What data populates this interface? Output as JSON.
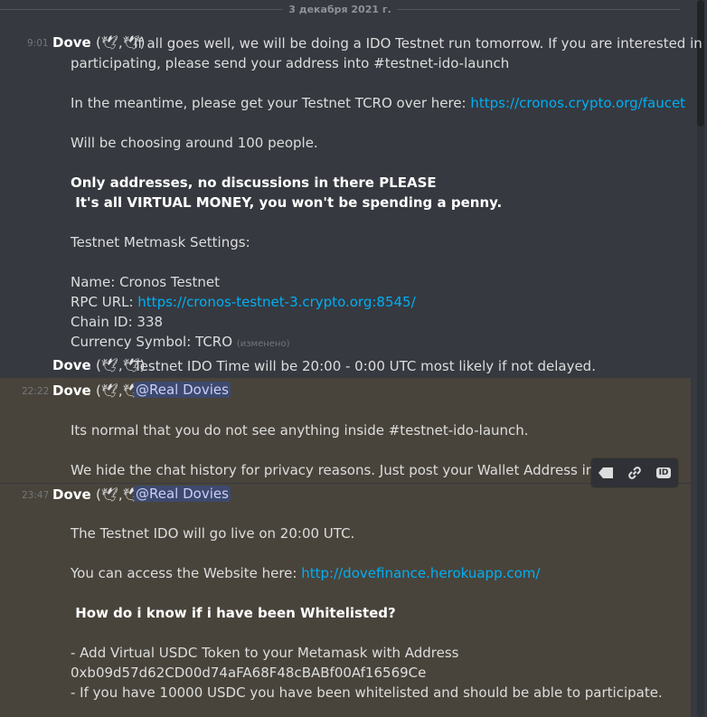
{
  "date_divider": "3 декабря 2021 г.",
  "messages": {
    "m1": {
      "timestamp": "9:01",
      "author": "Dove",
      "author_emoji": "(🕊,🕊)",
      "first_line": "If all goes well, we will be doing a IDO Testnet run tomorrow. If you are interested in",
      "lines": [
        "participating, please send your address into #testnet-ido-launch",
        "In the meantime, please get your Testnet TCRO over here: ",
        "Will be choosing around 100 people.",
        "Only addresses, no discussions in there PLEASE",
        " It's all VIRTUAL MONEY, you won't be spending a penny.",
        "Testnet Metmask Settings:",
        "Name: Cronos Testnet",
        "RPC URL: ",
        "Chain ID: 338",
        "Currency Symbol: TCRO "
      ],
      "faucet_link": "https://cronos.crypto.org/faucet",
      "rpc_link": "https://cronos-testnet-3.crypto.org:8545/",
      "edited": "(изменено)"
    },
    "m2": {
      "author": "Dove",
      "author_emoji": "(🕊,🕊)",
      "text": "Testnet IDO Time will be 20:00 - 0:00 UTC most likely if not delayed."
    },
    "m3": {
      "timestamp": "22:22",
      "author": "Dove",
      "author_emoji": "(🕊,🕊)",
      "mention": "@Real Dovies",
      "lines": [
        "Its normal that you do not see anything inside #testnet-ido-launch.",
        "We hide the chat history for privacy reasons. Just post your Wallet Address inside"
      ]
    },
    "m4": {
      "timestamp": "23:47",
      "author": "Dove",
      "author_emoji": "(🕊,🕊)",
      "mention": "@Real Dovies",
      "lines": [
        "The Testnet IDO will go live on 20:00 UTC.",
        "You can access the Website here: ",
        " How do i know if i have been Whitelisted?",
        "- Add Virtual USDC Token to your Metamask with Address",
        "0xb09d57d62CD00d74aFA68F48cBABf00Af16569Ce",
        "- If you have 10000 USDC you have been whitelisted and should be able to participate."
      ],
      "website_link": "http://dovefinance.herokuapp.com/"
    }
  },
  "toolbar": {
    "id_label": "ID"
  },
  "colors": {
    "background": "#36393f",
    "mention_highlight": "#49443b",
    "mention_bar": "#faa81a",
    "link": "#00aff4"
  }
}
